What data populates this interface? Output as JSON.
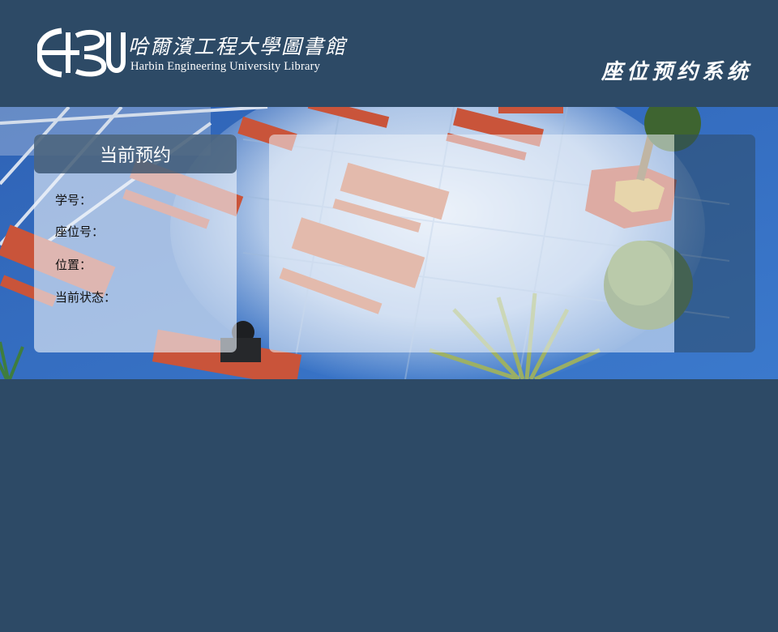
{
  "header": {
    "logo_cn": "哈爾濱工程大學圖書館",
    "logo_en": "Harbin Engineering University Library",
    "system_title": "座位预约系统"
  },
  "reservation": {
    "title": "当前预约",
    "fields": [
      {
        "label": "学号：",
        "value": ""
      },
      {
        "label": "座位号：",
        "value": ""
      },
      {
        "label": "位置：",
        "value": ""
      },
      {
        "label": "当前状态：",
        "value": ""
      }
    ]
  },
  "colors": {
    "background": "#2d4a66",
    "floor": "#3a72c4",
    "bench": "#c9543a"
  }
}
